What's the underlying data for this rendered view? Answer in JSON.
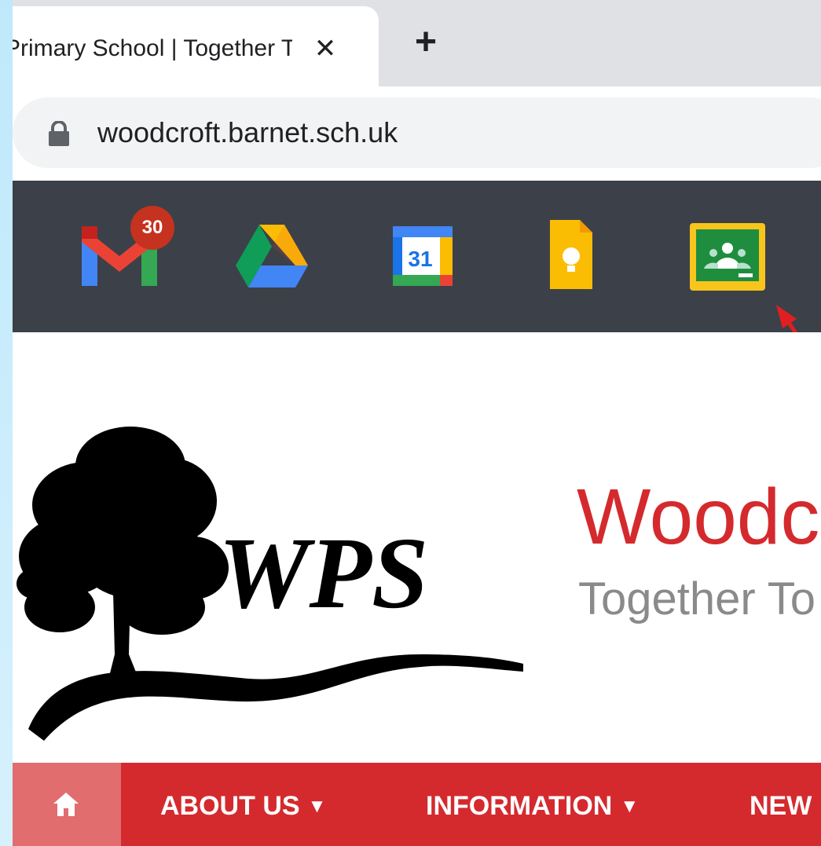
{
  "browser": {
    "tab": {
      "title": "Primary School | Together To",
      "close_icon": "✕"
    },
    "new_tab_icon": "+",
    "address_bar": {
      "url": "woodcroft.barnet.sch.uk",
      "lock_icon": "lock-icon"
    }
  },
  "bookmarks": {
    "items": [
      {
        "name": "gmail",
        "icon": "gmail-icon",
        "badge": "30"
      },
      {
        "name": "drive",
        "icon": "google-drive-icon"
      },
      {
        "name": "calendar",
        "icon": "google-calendar-icon",
        "date": "31"
      },
      {
        "name": "keep",
        "icon": "google-keep-icon"
      },
      {
        "name": "classroom",
        "icon": "google-classroom-icon",
        "highlighted": true
      }
    ],
    "annotation_arrow_color": "#e02020"
  },
  "site": {
    "logo_text": "WPS",
    "name": "Woodc",
    "motto": "Together To",
    "colors": {
      "brand_red": "#d42a2e",
      "motto_gray": "#8a8a8a"
    },
    "nav": {
      "home_icon": "home-icon",
      "items": [
        {
          "label": "ABOUT US",
          "has_dropdown": true
        },
        {
          "label": "INFORMATION",
          "has_dropdown": true
        },
        {
          "label": "NEW",
          "has_dropdown": false
        }
      ]
    }
  }
}
